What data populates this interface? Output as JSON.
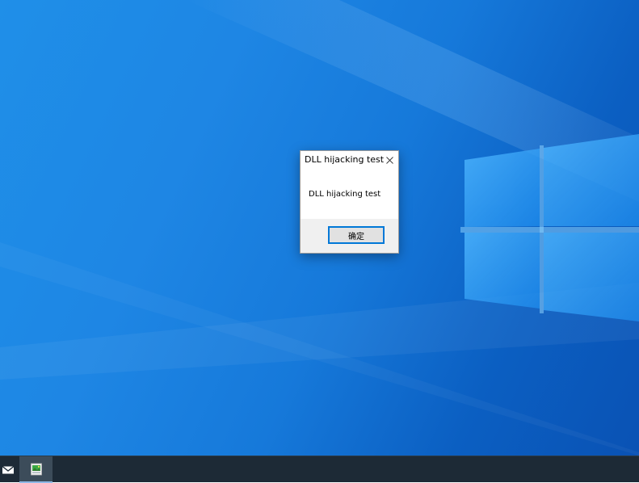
{
  "dialog": {
    "title": "DLL hijacking test",
    "message": "DLL hijacking test",
    "ok_label": "确定",
    "close_icon": "close-icon"
  },
  "taskbar": {
    "items": [
      {
        "icon": "mail-icon"
      },
      {
        "icon": "app-icon",
        "active": true
      }
    ]
  },
  "colors": {
    "desktop_accent": "#1679da",
    "taskbar": "#1d2a36",
    "button_focus": "#0078d7"
  }
}
